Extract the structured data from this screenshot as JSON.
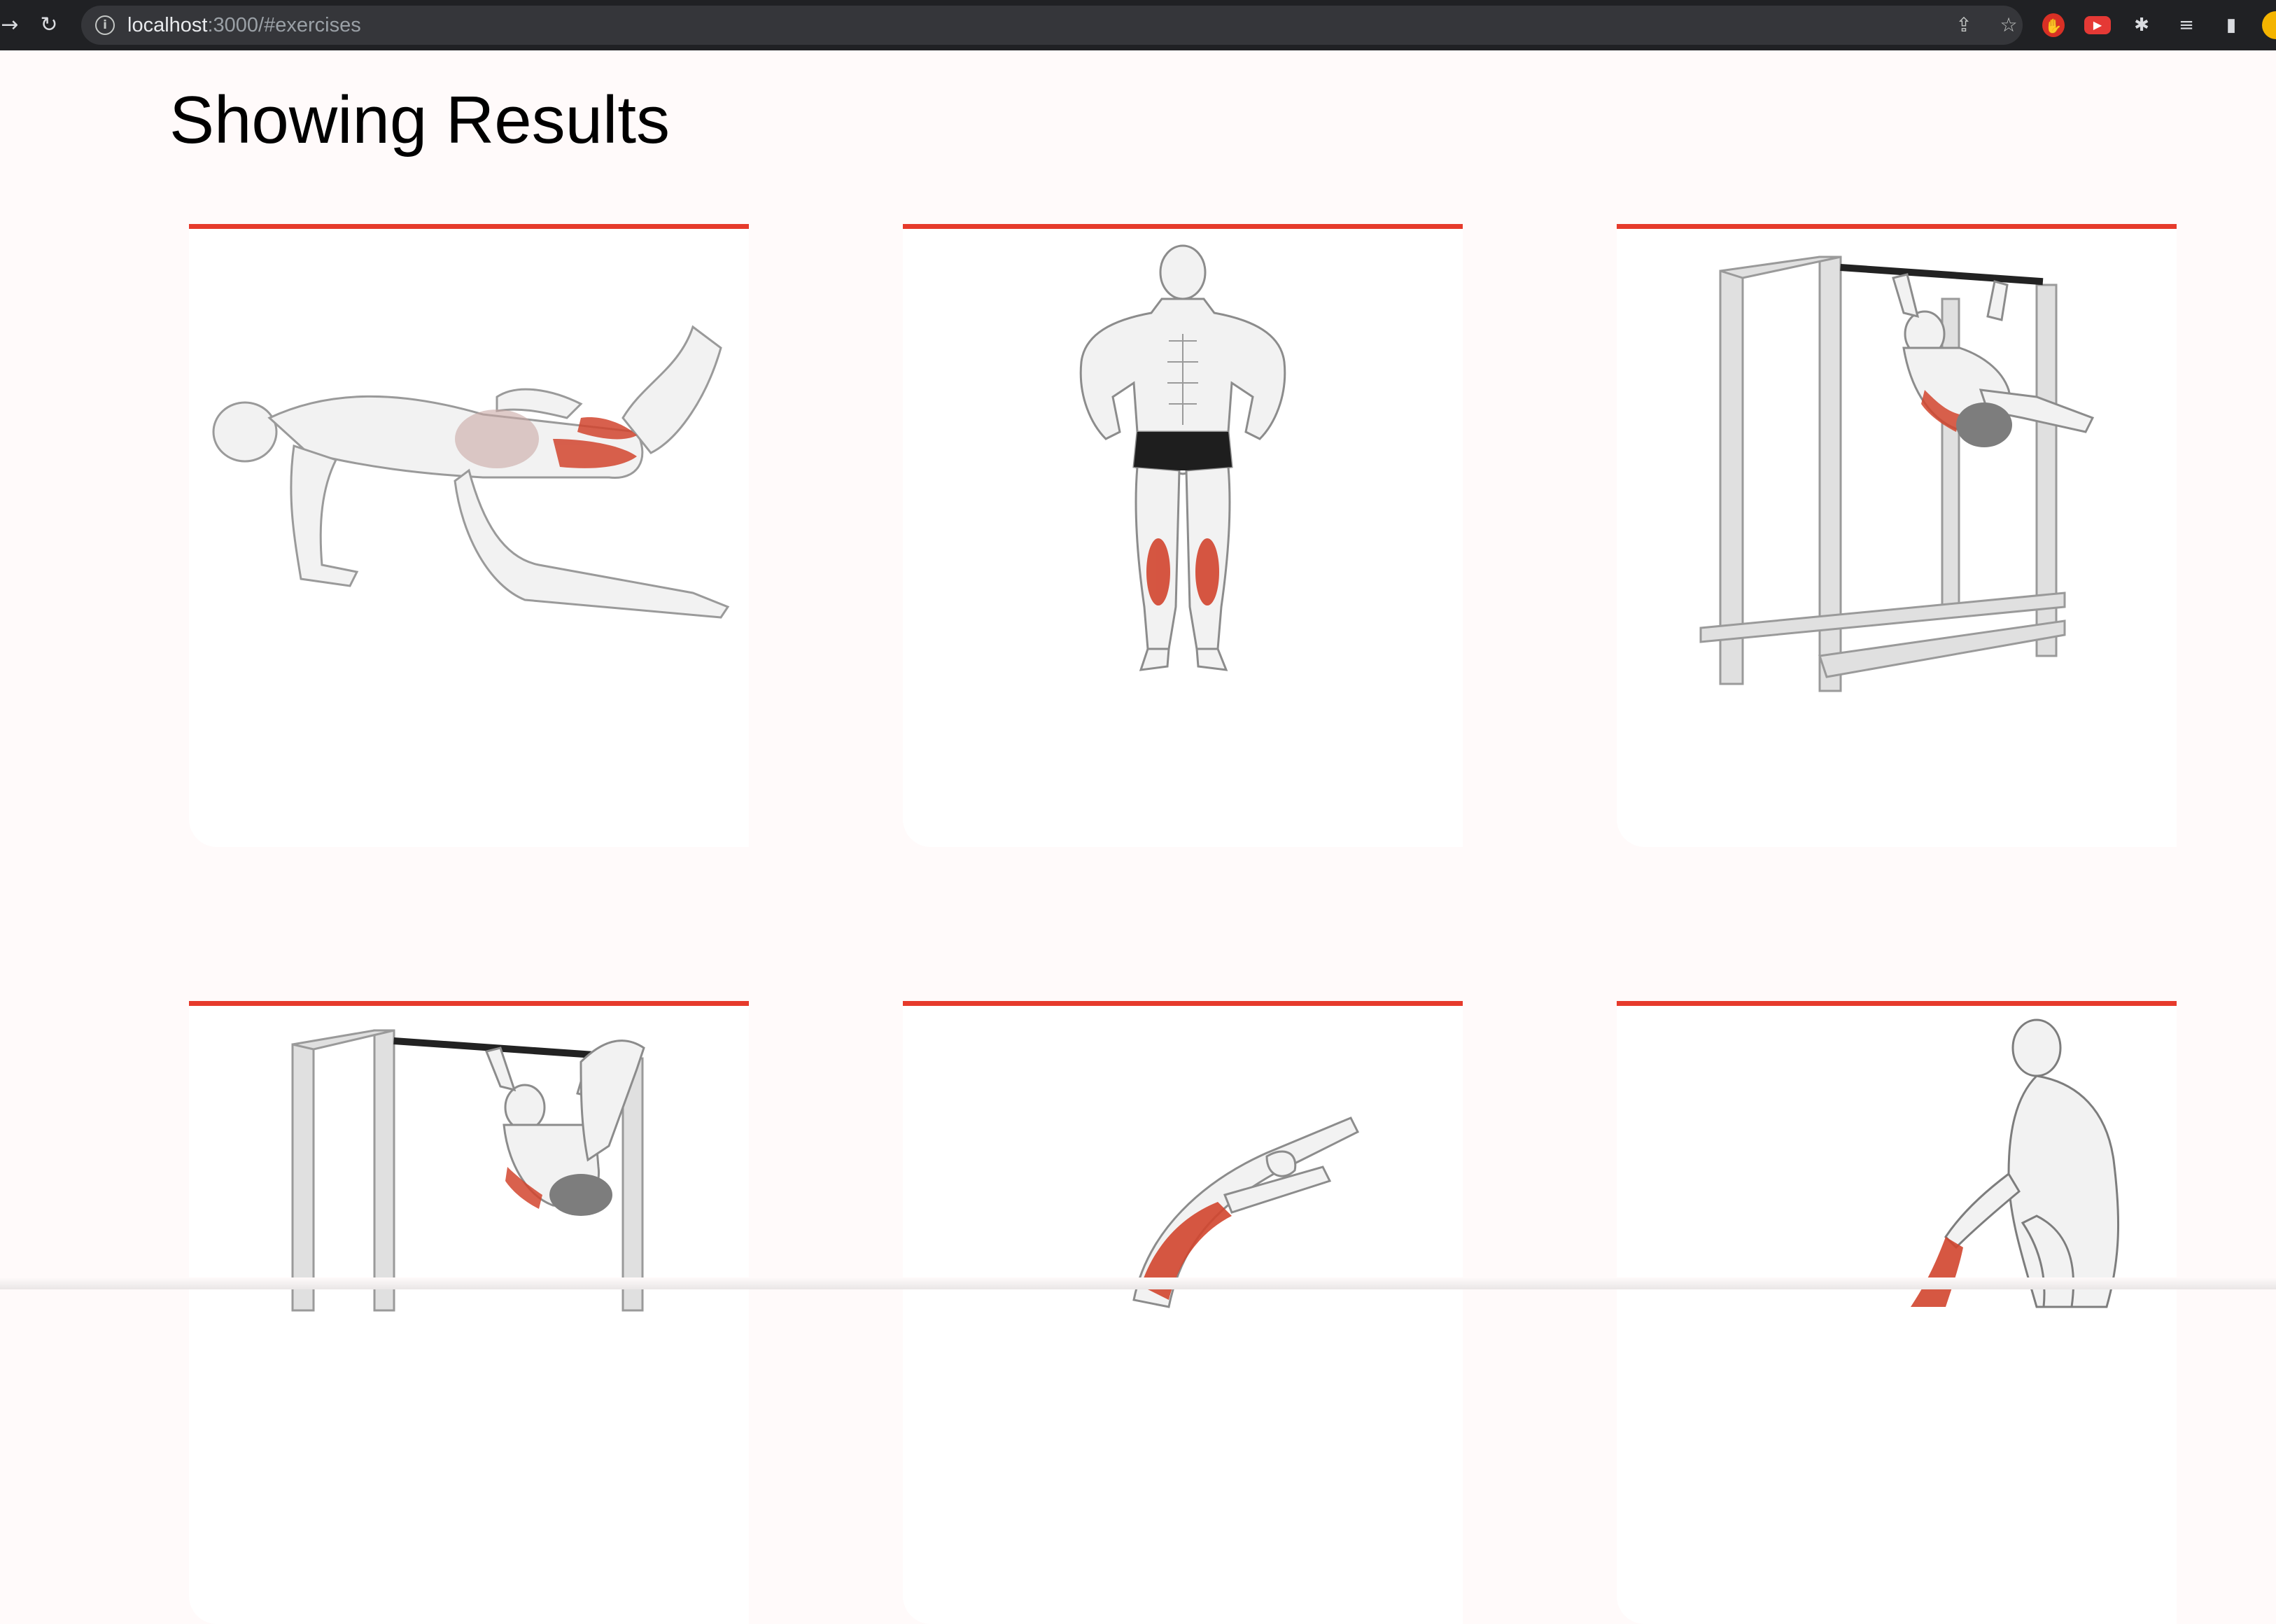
{
  "browser": {
    "url_host": "localhost",
    "url_rest": ":3000/#exercises",
    "icons": [
      "back-arrow-icon",
      "reload-icon",
      "info-icon",
      "share-icon",
      "star-icon",
      "ublock-icon",
      "youtube-ext-icon",
      "puzzle-icon",
      "reading-list-icon",
      "side-panel-icon",
      "profile-avatar-icon"
    ]
  },
  "page": {
    "title": "Showing Results"
  },
  "exercises": [
    {
      "image": "kneeling hamstring kickback exercise illustration"
    },
    {
      "image": "standing calf raise exercise illustration"
    },
    {
      "image": "hanging knee raise on pull-up frame exercise illustration"
    },
    {
      "image": "hanging leg raise on pull-up frame exercise illustration"
    },
    {
      "image": "standing back stretch exercise illustration"
    },
    {
      "image": "standing quad stretch exercise illustration"
    }
  ],
  "colors": {
    "accent": "#e63a2b",
    "background": "#fffafa",
    "muscle_highlight": "#d2452e"
  }
}
